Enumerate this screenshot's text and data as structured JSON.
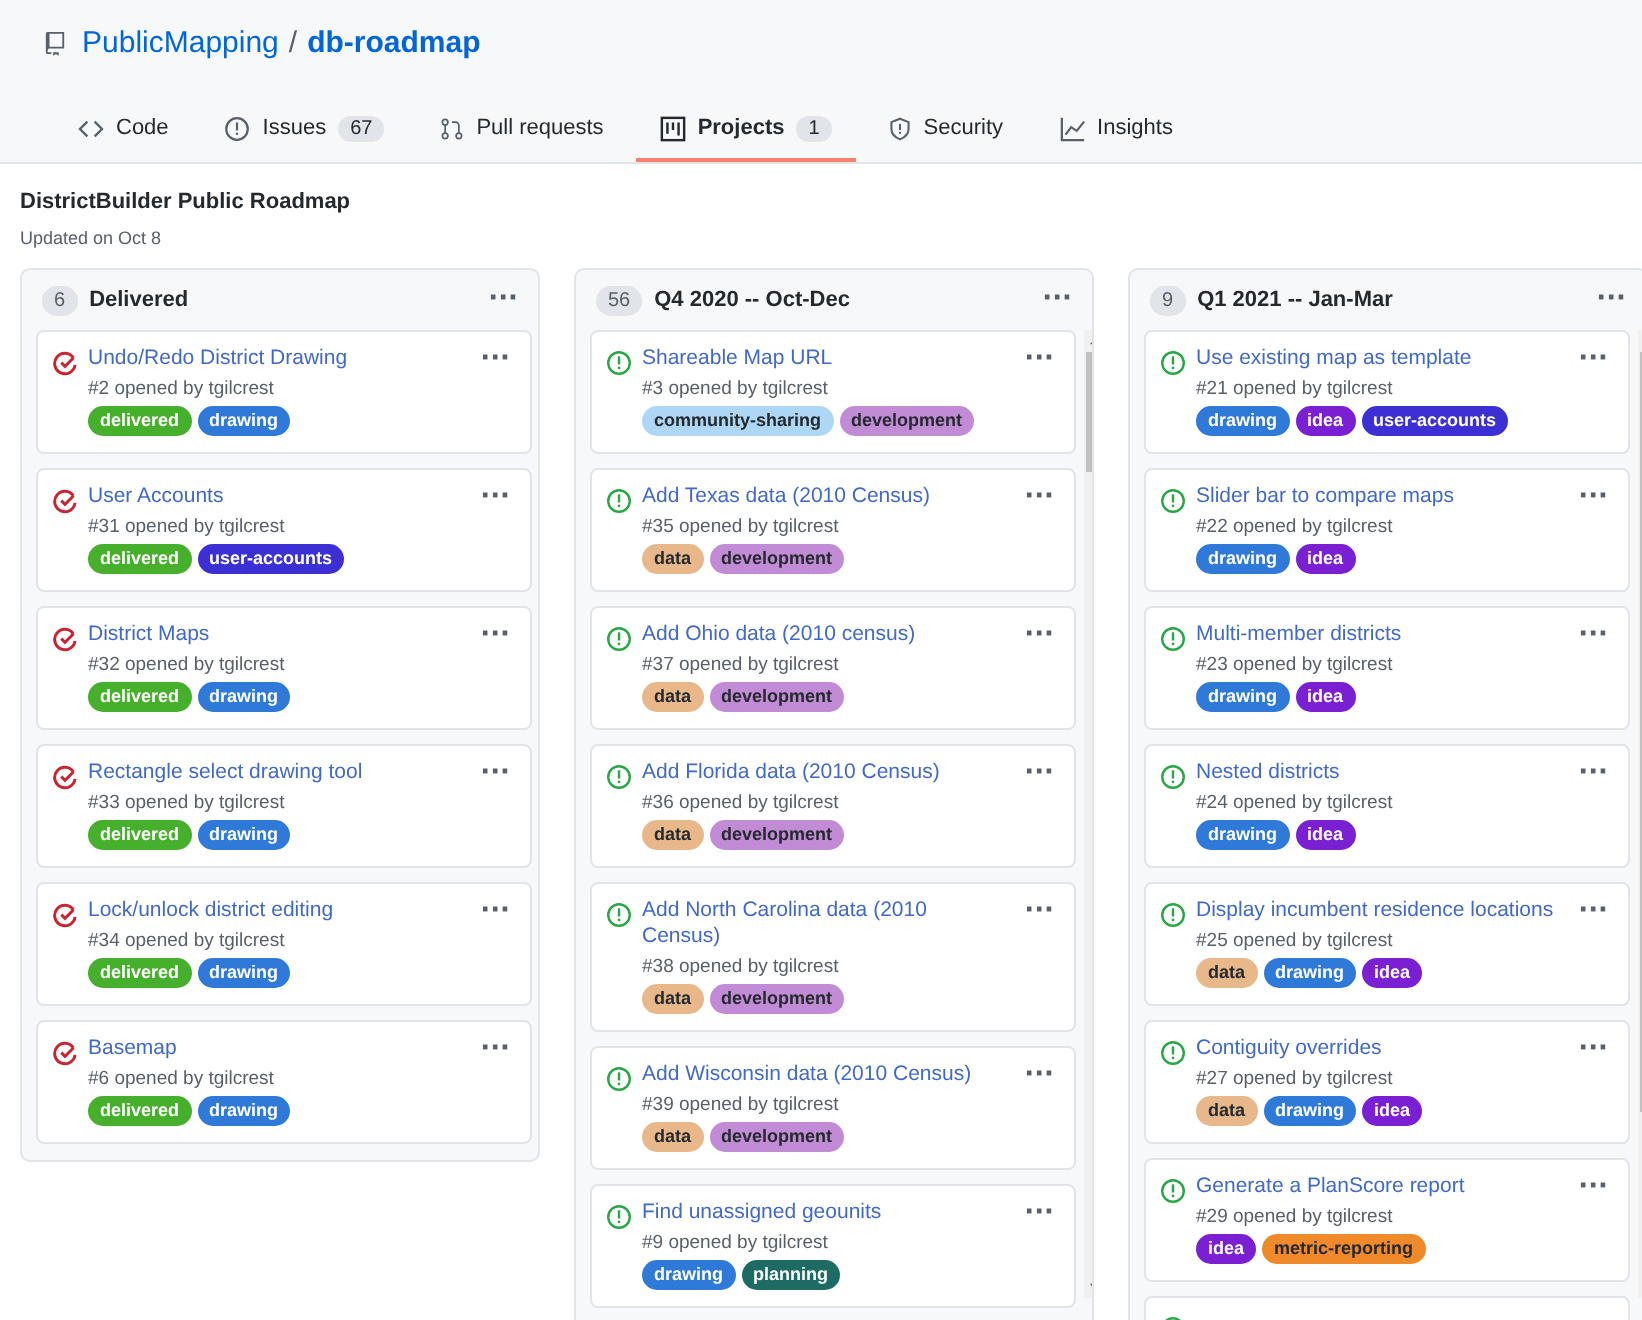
{
  "repo": {
    "owner": "PublicMapping",
    "separator": "/",
    "name": "db-roadmap"
  },
  "tabs": [
    {
      "label": "Code",
      "selected": false
    },
    {
      "label": "Issues",
      "count": "67",
      "selected": false
    },
    {
      "label": "Pull requests",
      "selected": false
    },
    {
      "label": "Projects",
      "count": "1",
      "selected": true
    },
    {
      "label": "Security",
      "selected": false
    },
    {
      "label": "Insights",
      "selected": false
    }
  ],
  "project": {
    "title": "DistrictBuilder Public Roadmap",
    "updated": "Updated on Oct 8"
  },
  "columns": [
    {
      "count": "6",
      "name": "Delivered",
      "menu": "···",
      "cards": [
        {
          "kind": "closed",
          "title": "Undo/Redo District Drawing",
          "meta": "#2 opened by tgilcrest",
          "menu": "···",
          "labels": [
            {
              "name": "delivered",
              "color": "#46b02c"
            },
            {
              "name": "drawing",
              "color": "#2f7ad8"
            }
          ]
        },
        {
          "kind": "closed",
          "title": "User Accounts",
          "meta": "#31 opened by tgilcrest",
          "menu": "···",
          "labels": [
            {
              "name": "delivered",
              "color": "#46b02c"
            },
            {
              "name": "user-accounts",
              "color": "#3c30d4"
            }
          ]
        },
        {
          "kind": "closed",
          "title": "District Maps",
          "meta": "#32 opened by tgilcrest",
          "menu": "···",
          "labels": [
            {
              "name": "delivered",
              "color": "#46b02c"
            },
            {
              "name": "drawing",
              "color": "#2f7ad8"
            }
          ]
        },
        {
          "kind": "closed",
          "title": "Rectangle select drawing tool",
          "meta": "#33 opened by tgilcrest",
          "menu": "···",
          "labels": [
            {
              "name": "delivered",
              "color": "#46b02c"
            },
            {
              "name": "drawing",
              "color": "#2f7ad8"
            }
          ]
        },
        {
          "kind": "closed",
          "title": "Lock/unlock district editing",
          "meta": "#34 opened by tgilcrest",
          "menu": "···",
          "labels": [
            {
              "name": "delivered",
              "color": "#46b02c"
            },
            {
              "name": "drawing",
              "color": "#2f7ad8"
            }
          ]
        },
        {
          "kind": "closed",
          "title": "Basemap",
          "meta": "#6 opened by tgilcrest",
          "menu": "···",
          "labels": [
            {
              "name": "delivered",
              "color": "#46b02c"
            },
            {
              "name": "drawing",
              "color": "#2f7ad8"
            }
          ]
        }
      ]
    },
    {
      "count": "56",
      "name": "Q4 2020 -- Oct-Dec",
      "menu": "···",
      "cards": [
        {
          "kind": "open",
          "title": "Shareable Map URL",
          "meta": "#3 opened by tgilcrest",
          "menu": "···",
          "labels": [
            {
              "name": "community-sharing",
              "color": "#aed6f5"
            },
            {
              "name": "development",
              "color": "#c28bd6"
            }
          ]
        },
        {
          "kind": "open",
          "title": "Add Texas data (2010 Census)",
          "meta": "#35 opened by tgilcrest",
          "menu": "···",
          "labels": [
            {
              "name": "data",
              "color": "#e8b88a"
            },
            {
              "name": "development",
              "color": "#c28bd6"
            }
          ]
        },
        {
          "kind": "open",
          "title": "Add Ohio data (2010 census)",
          "meta": "#37 opened by tgilcrest",
          "menu": "···",
          "labels": [
            {
              "name": "data",
              "color": "#e8b88a"
            },
            {
              "name": "development",
              "color": "#c28bd6"
            }
          ]
        },
        {
          "kind": "open",
          "title": "Add Florida data (2010 Census)",
          "meta": "#36 opened by tgilcrest",
          "menu": "···",
          "labels": [
            {
              "name": "data",
              "color": "#e8b88a"
            },
            {
              "name": "development",
              "color": "#c28bd6"
            }
          ]
        },
        {
          "kind": "open",
          "title": "Add North Carolina data (2010 Census)",
          "meta": "#38 opened by tgilcrest",
          "menu": "···",
          "labels": [
            {
              "name": "data",
              "color": "#e8b88a"
            },
            {
              "name": "development",
              "color": "#c28bd6"
            }
          ]
        },
        {
          "kind": "open",
          "title": "Add Wisconsin data (2010 Census)",
          "meta": "#39 opened by tgilcrest",
          "menu": "···",
          "labels": [
            {
              "name": "data",
              "color": "#e8b88a"
            },
            {
              "name": "development",
              "color": "#c28bd6"
            }
          ]
        },
        {
          "kind": "open",
          "title": "Find unassigned geounits",
          "meta": "#9 opened by tgilcrest",
          "menu": "···",
          "labels": [
            {
              "name": "drawing",
              "color": "#2f7ad8"
            },
            {
              "name": "planning",
              "color": "#1e6b64"
            }
          ]
        }
      ]
    },
    {
      "count": "9",
      "name": "Q1 2021 -- Jan-Mar",
      "menu": "···",
      "cards": [
        {
          "kind": "open",
          "title": "Use existing map as template",
          "meta": "#21 opened by tgilcrest",
          "menu": "···",
          "labels": [
            {
              "name": "drawing",
              "color": "#2f7ad8"
            },
            {
              "name": "idea",
              "color": "#7a1fd2"
            },
            {
              "name": "user-accounts",
              "color": "#3c30d4"
            }
          ]
        },
        {
          "kind": "open",
          "title": "Slider bar to compare maps",
          "meta": "#22 opened by tgilcrest",
          "menu": "···",
          "labels": [
            {
              "name": "drawing",
              "color": "#2f7ad8"
            },
            {
              "name": "idea",
              "color": "#7a1fd2"
            }
          ]
        },
        {
          "kind": "open",
          "title": "Multi-member districts",
          "meta": "#23 opened by tgilcrest",
          "menu": "···",
          "labels": [
            {
              "name": "drawing",
              "color": "#2f7ad8"
            },
            {
              "name": "idea",
              "color": "#7a1fd2"
            }
          ]
        },
        {
          "kind": "open",
          "title": "Nested districts",
          "meta": "#24 opened by tgilcrest",
          "menu": "···",
          "labels": [
            {
              "name": "drawing",
              "color": "#2f7ad8"
            },
            {
              "name": "idea",
              "color": "#7a1fd2"
            }
          ]
        },
        {
          "kind": "open",
          "title": "Display incumbent residence locations",
          "meta": "#25 opened by tgilcrest",
          "menu": "···",
          "labels": [
            {
              "name": "data",
              "color": "#e8b88a"
            },
            {
              "name": "drawing",
              "color": "#2f7ad8"
            },
            {
              "name": "idea",
              "color": "#7a1fd2"
            }
          ]
        },
        {
          "kind": "open",
          "title": "Contiguity overrides",
          "meta": "#27 opened by tgilcrest",
          "menu": "···",
          "labels": [
            {
              "name": "data",
              "color": "#e8b88a"
            },
            {
              "name": "drawing",
              "color": "#2f7ad8"
            },
            {
              "name": "idea",
              "color": "#7a1fd2"
            }
          ]
        },
        {
          "kind": "open",
          "title": "Generate a PlanScore report",
          "meta": "#29 opened by tgilcrest",
          "menu": "···",
          "labels": [
            {
              "name": "idea",
              "color": "#7a1fd2"
            },
            {
              "name": "metric-reporting",
              "color": "#f0892a"
            }
          ]
        },
        {
          "kind": "open"
        }
      ]
    }
  ]
}
